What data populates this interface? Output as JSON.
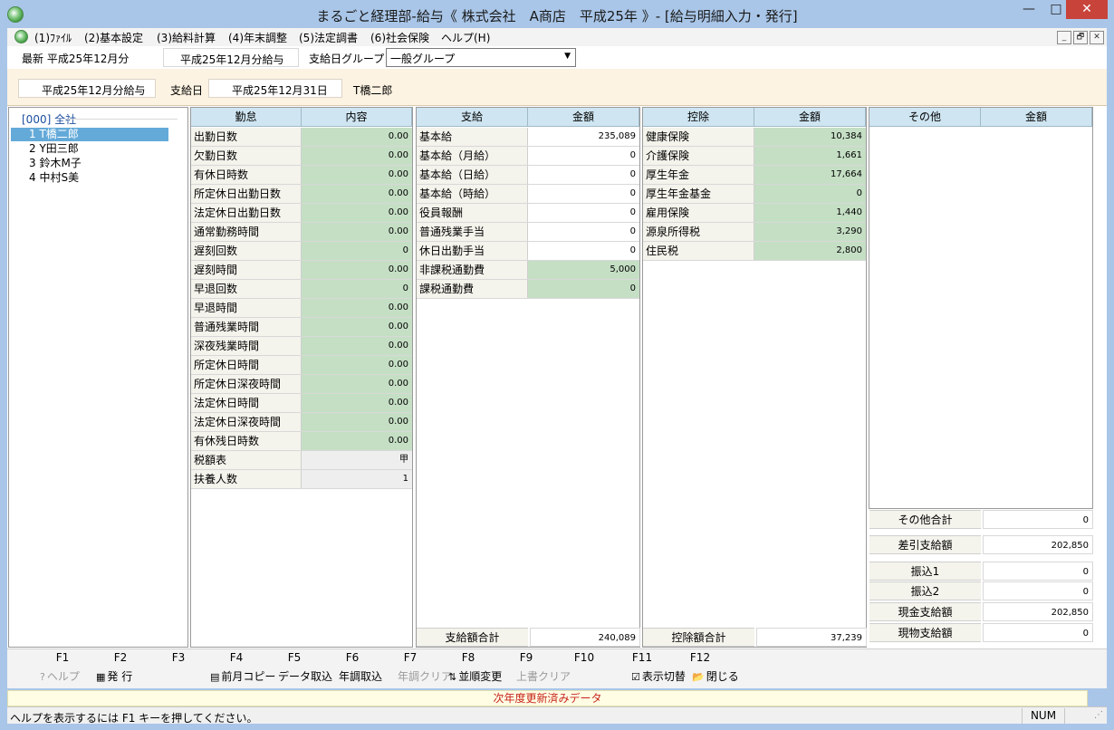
{
  "window": {
    "title": "まるごと経理部-給与《 株式会社　A商店　平成25年 》- [給与明細入力・発行]",
    "min": "—",
    "max": "□",
    "close": "✕"
  },
  "menu": [
    "(1)ﾌｧｲﾙ",
    "(2)基本設定",
    "(3)給料計算",
    "(4)年末調整",
    "(5)法定調書",
    "(6)社会保険",
    "ヘルプ(H)"
  ],
  "mdi": [
    "_",
    "🗗",
    "✕"
  ],
  "top": {
    "latest": "最新 平成25年12月分",
    "period": "平成25年12月分給与",
    "paygroup_label": "支給日グループ",
    "paygroup_value": "一般グループ"
  },
  "info": {
    "period": "平成25年12月分給与",
    "paydate_label": "支給日",
    "paydate": "平成25年12月31日",
    "employee": "T橋二郎"
  },
  "employees": {
    "all": "[000] 全社",
    "items": [
      "1 T橋二郎",
      "2 Y田三郎",
      "3 鈴木M子",
      "4 中村S美"
    ],
    "selected": 0
  },
  "attendance": {
    "headers": [
      "勤怠",
      "内容"
    ],
    "rows": [
      {
        "label": "出勤日数",
        "value": "0.00"
      },
      {
        "label": "欠勤日数",
        "value": "0.00"
      },
      {
        "label": "有休日時数",
        "value": "0.00"
      },
      {
        "label": "所定休日出勤日数",
        "value": "0.00"
      },
      {
        "label": "法定休日出勤日数",
        "value": "0.00"
      },
      {
        "label": "通常勤務時間",
        "value": "0.00"
      },
      {
        "label": "遅刻回数",
        "value": "0"
      },
      {
        "label": "遅刻時間",
        "value": "0.00"
      },
      {
        "label": "早退回数",
        "value": "0"
      },
      {
        "label": "早退時間",
        "value": "0.00"
      },
      {
        "label": "普通残業時間",
        "value": "0.00"
      },
      {
        "label": "深夜残業時間",
        "value": "0.00"
      },
      {
        "label": "所定休日時間",
        "value": "0.00"
      },
      {
        "label": "所定休日深夜時間",
        "value": "0.00"
      },
      {
        "label": "法定休日時間",
        "value": "0.00"
      },
      {
        "label": "法定休日深夜時間",
        "value": "0.00"
      },
      {
        "label": "有休残日時数",
        "value": "0.00"
      },
      {
        "label": "税額表",
        "value": "甲"
      },
      {
        "label": "扶養人数",
        "value": "1"
      }
    ]
  },
  "payments": {
    "headers": [
      "支給",
      "金額"
    ],
    "rows": [
      {
        "label": "基本給",
        "value": "235,089"
      },
      {
        "label": "基本給（月給）",
        "value": "0"
      },
      {
        "label": "基本給（日給）",
        "value": "0"
      },
      {
        "label": "基本給（時給）",
        "value": "0"
      },
      {
        "label": "役員報酬",
        "value": "0"
      },
      {
        "label": "普通残業手当",
        "value": "0"
      },
      {
        "label": "休日出勤手当",
        "value": "0"
      },
      {
        "label": "非課税通勤費",
        "value": "5,000"
      },
      {
        "label": "課税通勤費",
        "value": "0"
      }
    ],
    "total_label": "支給額合計",
    "total": "240,089"
  },
  "deductions": {
    "headers": [
      "控除",
      "金額"
    ],
    "rows": [
      {
        "label": "健康保険",
        "value": "10,384"
      },
      {
        "label": "介護保険",
        "value": "1,661"
      },
      {
        "label": "厚生年金",
        "value": "17,664"
      },
      {
        "label": "厚生年金基金",
        "value": "0"
      },
      {
        "label": "雇用保険",
        "value": "1,440"
      },
      {
        "label": "源泉所得税",
        "value": "3,290"
      },
      {
        "label": "住民税",
        "value": "2,800"
      }
    ],
    "total_label": "控除額合計",
    "total": "37,239"
  },
  "other": {
    "headers": [
      "その他",
      "金額"
    ],
    "summary": [
      {
        "label": "その他合計",
        "value": "0"
      },
      {
        "label": "差引支給額",
        "value": "202,850"
      },
      {
        "label": "振込1",
        "value": "0"
      },
      {
        "label": "振込2",
        "value": "0"
      },
      {
        "label": "現金支給額",
        "value": "202,850"
      },
      {
        "label": "現物支給額",
        "value": "0"
      }
    ]
  },
  "fkeys": {
    "keys": [
      "F1",
      "F2",
      "F3",
      "F4",
      "F5",
      "F6",
      "F7",
      "F8",
      "F9",
      "F10",
      "F11",
      "F12"
    ],
    "help": "ヘルプ",
    "issue": "発 行",
    "prev_copy": "前月コピー",
    "data_import": "データ取込",
    "yearend_import": "年調取込",
    "yearend_clear": "年調クリア",
    "reorder": "並順変更",
    "overwrite_clear": "上書クリア",
    "view_toggle": "表示切替",
    "close": "閉じる"
  },
  "notice": "次年度更新済みデータ",
  "status": {
    "text": "ヘルプを表示するには F1 キーを押してください。",
    "num": "NUM"
  }
}
